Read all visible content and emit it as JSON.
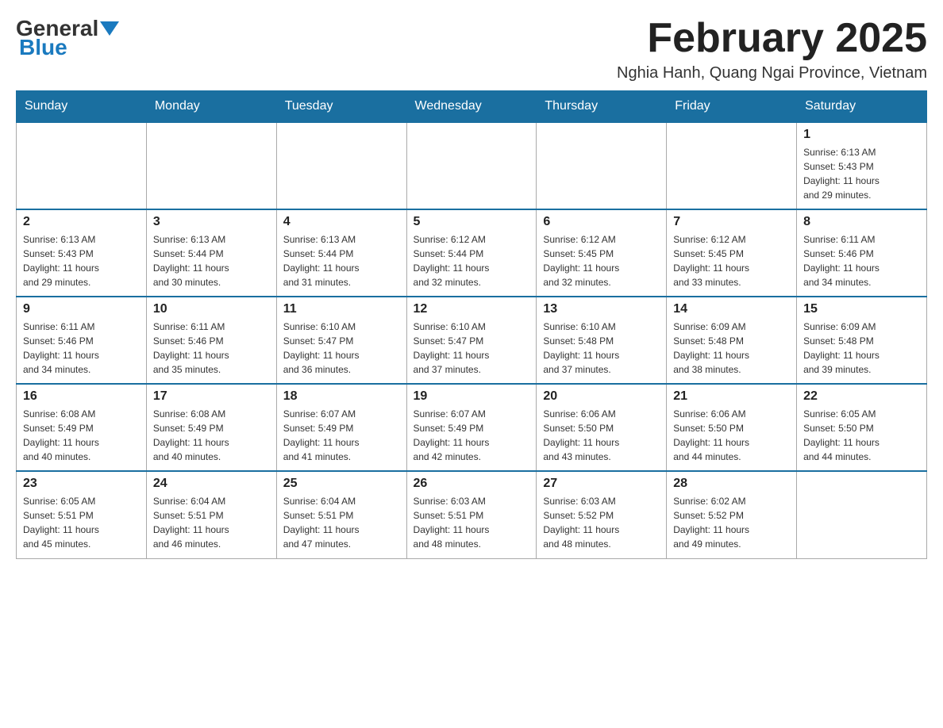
{
  "logo": {
    "general": "General",
    "blue": "Blue"
  },
  "title": "February 2025",
  "location": "Nghia Hanh, Quang Ngai Province, Vietnam",
  "days_header": [
    "Sunday",
    "Monday",
    "Tuesday",
    "Wednesday",
    "Thursday",
    "Friday",
    "Saturday"
  ],
  "weeks": [
    {
      "days": [
        {
          "num": "",
          "info": ""
        },
        {
          "num": "",
          "info": ""
        },
        {
          "num": "",
          "info": ""
        },
        {
          "num": "",
          "info": ""
        },
        {
          "num": "",
          "info": ""
        },
        {
          "num": "",
          "info": ""
        },
        {
          "num": "1",
          "info": "Sunrise: 6:13 AM\nSunset: 5:43 PM\nDaylight: 11 hours\nand 29 minutes."
        }
      ]
    },
    {
      "days": [
        {
          "num": "2",
          "info": "Sunrise: 6:13 AM\nSunset: 5:43 PM\nDaylight: 11 hours\nand 29 minutes."
        },
        {
          "num": "3",
          "info": "Sunrise: 6:13 AM\nSunset: 5:44 PM\nDaylight: 11 hours\nand 30 minutes."
        },
        {
          "num": "4",
          "info": "Sunrise: 6:13 AM\nSunset: 5:44 PM\nDaylight: 11 hours\nand 31 minutes."
        },
        {
          "num": "5",
          "info": "Sunrise: 6:12 AM\nSunset: 5:44 PM\nDaylight: 11 hours\nand 32 minutes."
        },
        {
          "num": "6",
          "info": "Sunrise: 6:12 AM\nSunset: 5:45 PM\nDaylight: 11 hours\nand 32 minutes."
        },
        {
          "num": "7",
          "info": "Sunrise: 6:12 AM\nSunset: 5:45 PM\nDaylight: 11 hours\nand 33 minutes."
        },
        {
          "num": "8",
          "info": "Sunrise: 6:11 AM\nSunset: 5:46 PM\nDaylight: 11 hours\nand 34 minutes."
        }
      ]
    },
    {
      "days": [
        {
          "num": "9",
          "info": "Sunrise: 6:11 AM\nSunset: 5:46 PM\nDaylight: 11 hours\nand 34 minutes."
        },
        {
          "num": "10",
          "info": "Sunrise: 6:11 AM\nSunset: 5:46 PM\nDaylight: 11 hours\nand 35 minutes."
        },
        {
          "num": "11",
          "info": "Sunrise: 6:10 AM\nSunset: 5:47 PM\nDaylight: 11 hours\nand 36 minutes."
        },
        {
          "num": "12",
          "info": "Sunrise: 6:10 AM\nSunset: 5:47 PM\nDaylight: 11 hours\nand 37 minutes."
        },
        {
          "num": "13",
          "info": "Sunrise: 6:10 AM\nSunset: 5:48 PM\nDaylight: 11 hours\nand 37 minutes."
        },
        {
          "num": "14",
          "info": "Sunrise: 6:09 AM\nSunset: 5:48 PM\nDaylight: 11 hours\nand 38 minutes."
        },
        {
          "num": "15",
          "info": "Sunrise: 6:09 AM\nSunset: 5:48 PM\nDaylight: 11 hours\nand 39 minutes."
        }
      ]
    },
    {
      "days": [
        {
          "num": "16",
          "info": "Sunrise: 6:08 AM\nSunset: 5:49 PM\nDaylight: 11 hours\nand 40 minutes."
        },
        {
          "num": "17",
          "info": "Sunrise: 6:08 AM\nSunset: 5:49 PM\nDaylight: 11 hours\nand 40 minutes."
        },
        {
          "num": "18",
          "info": "Sunrise: 6:07 AM\nSunset: 5:49 PM\nDaylight: 11 hours\nand 41 minutes."
        },
        {
          "num": "19",
          "info": "Sunrise: 6:07 AM\nSunset: 5:49 PM\nDaylight: 11 hours\nand 42 minutes."
        },
        {
          "num": "20",
          "info": "Sunrise: 6:06 AM\nSunset: 5:50 PM\nDaylight: 11 hours\nand 43 minutes."
        },
        {
          "num": "21",
          "info": "Sunrise: 6:06 AM\nSunset: 5:50 PM\nDaylight: 11 hours\nand 44 minutes."
        },
        {
          "num": "22",
          "info": "Sunrise: 6:05 AM\nSunset: 5:50 PM\nDaylight: 11 hours\nand 44 minutes."
        }
      ]
    },
    {
      "days": [
        {
          "num": "23",
          "info": "Sunrise: 6:05 AM\nSunset: 5:51 PM\nDaylight: 11 hours\nand 45 minutes."
        },
        {
          "num": "24",
          "info": "Sunrise: 6:04 AM\nSunset: 5:51 PM\nDaylight: 11 hours\nand 46 minutes."
        },
        {
          "num": "25",
          "info": "Sunrise: 6:04 AM\nSunset: 5:51 PM\nDaylight: 11 hours\nand 47 minutes."
        },
        {
          "num": "26",
          "info": "Sunrise: 6:03 AM\nSunset: 5:51 PM\nDaylight: 11 hours\nand 48 minutes."
        },
        {
          "num": "27",
          "info": "Sunrise: 6:03 AM\nSunset: 5:52 PM\nDaylight: 11 hours\nand 48 minutes."
        },
        {
          "num": "28",
          "info": "Sunrise: 6:02 AM\nSunset: 5:52 PM\nDaylight: 11 hours\nand 49 minutes."
        },
        {
          "num": "",
          "info": ""
        }
      ]
    }
  ]
}
